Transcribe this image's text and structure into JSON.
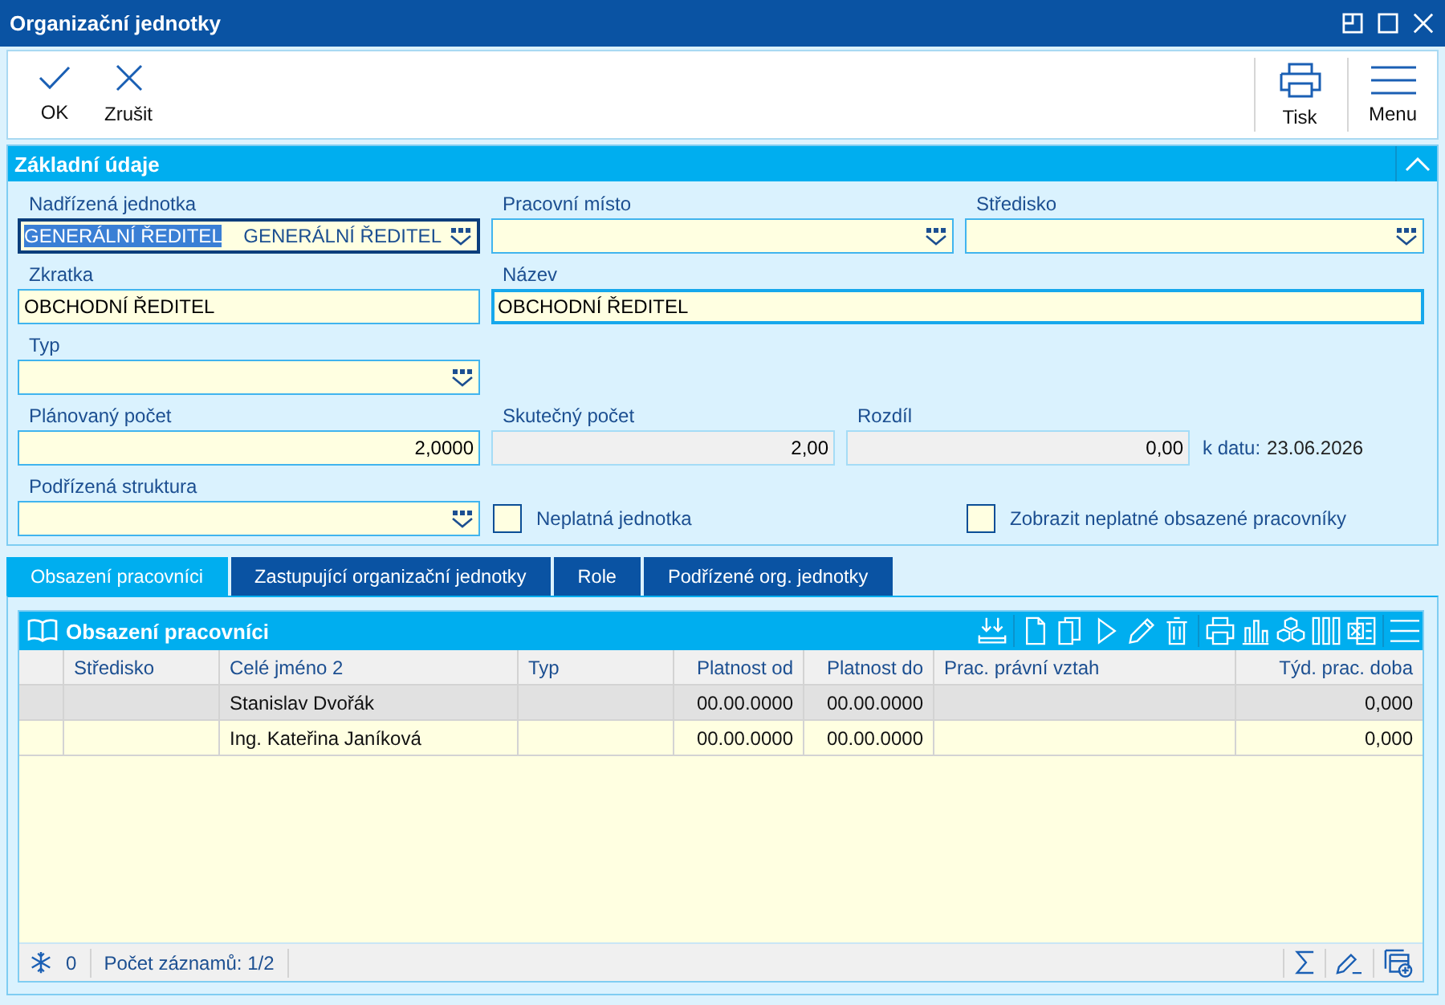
{
  "window": {
    "title": "Organizační jednotky"
  },
  "toolbar": {
    "left": [
      {
        "kind": "check",
        "label": "OK"
      },
      {
        "kind": "cross",
        "label": "Zrušit"
      }
    ],
    "right": [
      {
        "kind": "printer",
        "label": "Tisk"
      },
      {
        "kind": "menu",
        "label": "Menu"
      }
    ]
  },
  "form": {
    "title": "Základní údaje",
    "expanded": true,
    "rows": [
      [
        {
          "kind": "lookup",
          "label": "Nadřízená jednotka",
          "value": "GENERÁLNÍ ŘEDITEL",
          "description": "GENERÁLNÍ ŘEDITEL",
          "focused": true,
          "required": false,
          "disabled": false
        },
        {
          "kind": "lookup",
          "label": "Pracovní místo",
          "focused": false,
          "required": false,
          "disabled": false
        },
        {
          "kind": "lookup",
          "label": "Středisko",
          "focused": false,
          "required": false,
          "disabled": false
        }
      ],
      [
        {
          "kind": "text",
          "label": "Zkratka",
          "value": "OBCHODNÍ ŘEDITEL",
          "focused": false,
          "required": false,
          "disabled": false
        },
        {
          "kind": "text",
          "label": "Název",
          "value": "OBCHODNÍ ŘEDITEL",
          "focused": false,
          "required": true,
          "disabled": false
        }
      ],
      [
        {
          "kind": "lookup",
          "label": "Typ",
          "focused": false,
          "required": false,
          "disabled": false
        }
      ],
      [
        {
          "kind": "number",
          "label": "Plánovaný počet",
          "value": "2,0000",
          "focused": false,
          "required": false,
          "disabled": false
        },
        {
          "kind": "number",
          "label": "Skutečný počet",
          "value": "2,00",
          "focused": false,
          "required": false,
          "disabled": true
        },
        {
          "kind": "number",
          "label": "Rozdíl",
          "value": "0,00",
          "focused": false,
          "required": false,
          "disabled": true
        },
        {
          "kind": "note",
          "prefix": "k datu:",
          "date": "23.06.2026"
        }
      ],
      [
        {
          "kind": "lookup",
          "label": "Podřízená struktura",
          "focused": false,
          "required": false,
          "disabled": false
        },
        {
          "kind": "checkbox",
          "label": "Neplatná jednotka",
          "checked": false
        },
        {
          "kind": "checkbox",
          "label": "Zobrazit neplatné obsazené pracovníky",
          "checked": false
        }
      ]
    ]
  },
  "tabs": [
    {
      "label": "Obsazení pracovníci",
      "selected": true
    },
    {
      "label": "Zastupující organizační jednotky",
      "selected": false
    },
    {
      "label": "Role",
      "selected": false
    },
    {
      "label": "Podřízené org. jednotky",
      "selected": false
    }
  ],
  "grid": {
    "title": "Obsazení pracovníci",
    "columns": [
      {
        "label": "Středisko",
        "kind": "text"
      },
      {
        "label": "Celé jméno 2",
        "kind": "text"
      },
      {
        "label": "Typ",
        "kind": "text"
      },
      {
        "label": "Platnost od",
        "kind": "date"
      },
      {
        "label": "Platnost do",
        "kind": "date"
      },
      {
        "label": "Prac. právní vztah",
        "kind": "text"
      },
      {
        "label": "Týd. prac. doba",
        "kind": "number"
      }
    ],
    "rows": [
      {
        "selected": true,
        "cells": [
          null,
          "Stanislav Dvořák",
          null,
          "00.00.0000",
          "00.00.0000",
          null,
          "0,000"
        ]
      },
      {
        "selected": false,
        "cells": [
          null,
          "Ing. Kateřina Janíková",
          null,
          "00.00.0000",
          "00.00.0000",
          null,
          "0,000"
        ]
      }
    ],
    "status": {
      "count": "0",
      "records": "Počet záznamů: 1/2"
    }
  }
}
